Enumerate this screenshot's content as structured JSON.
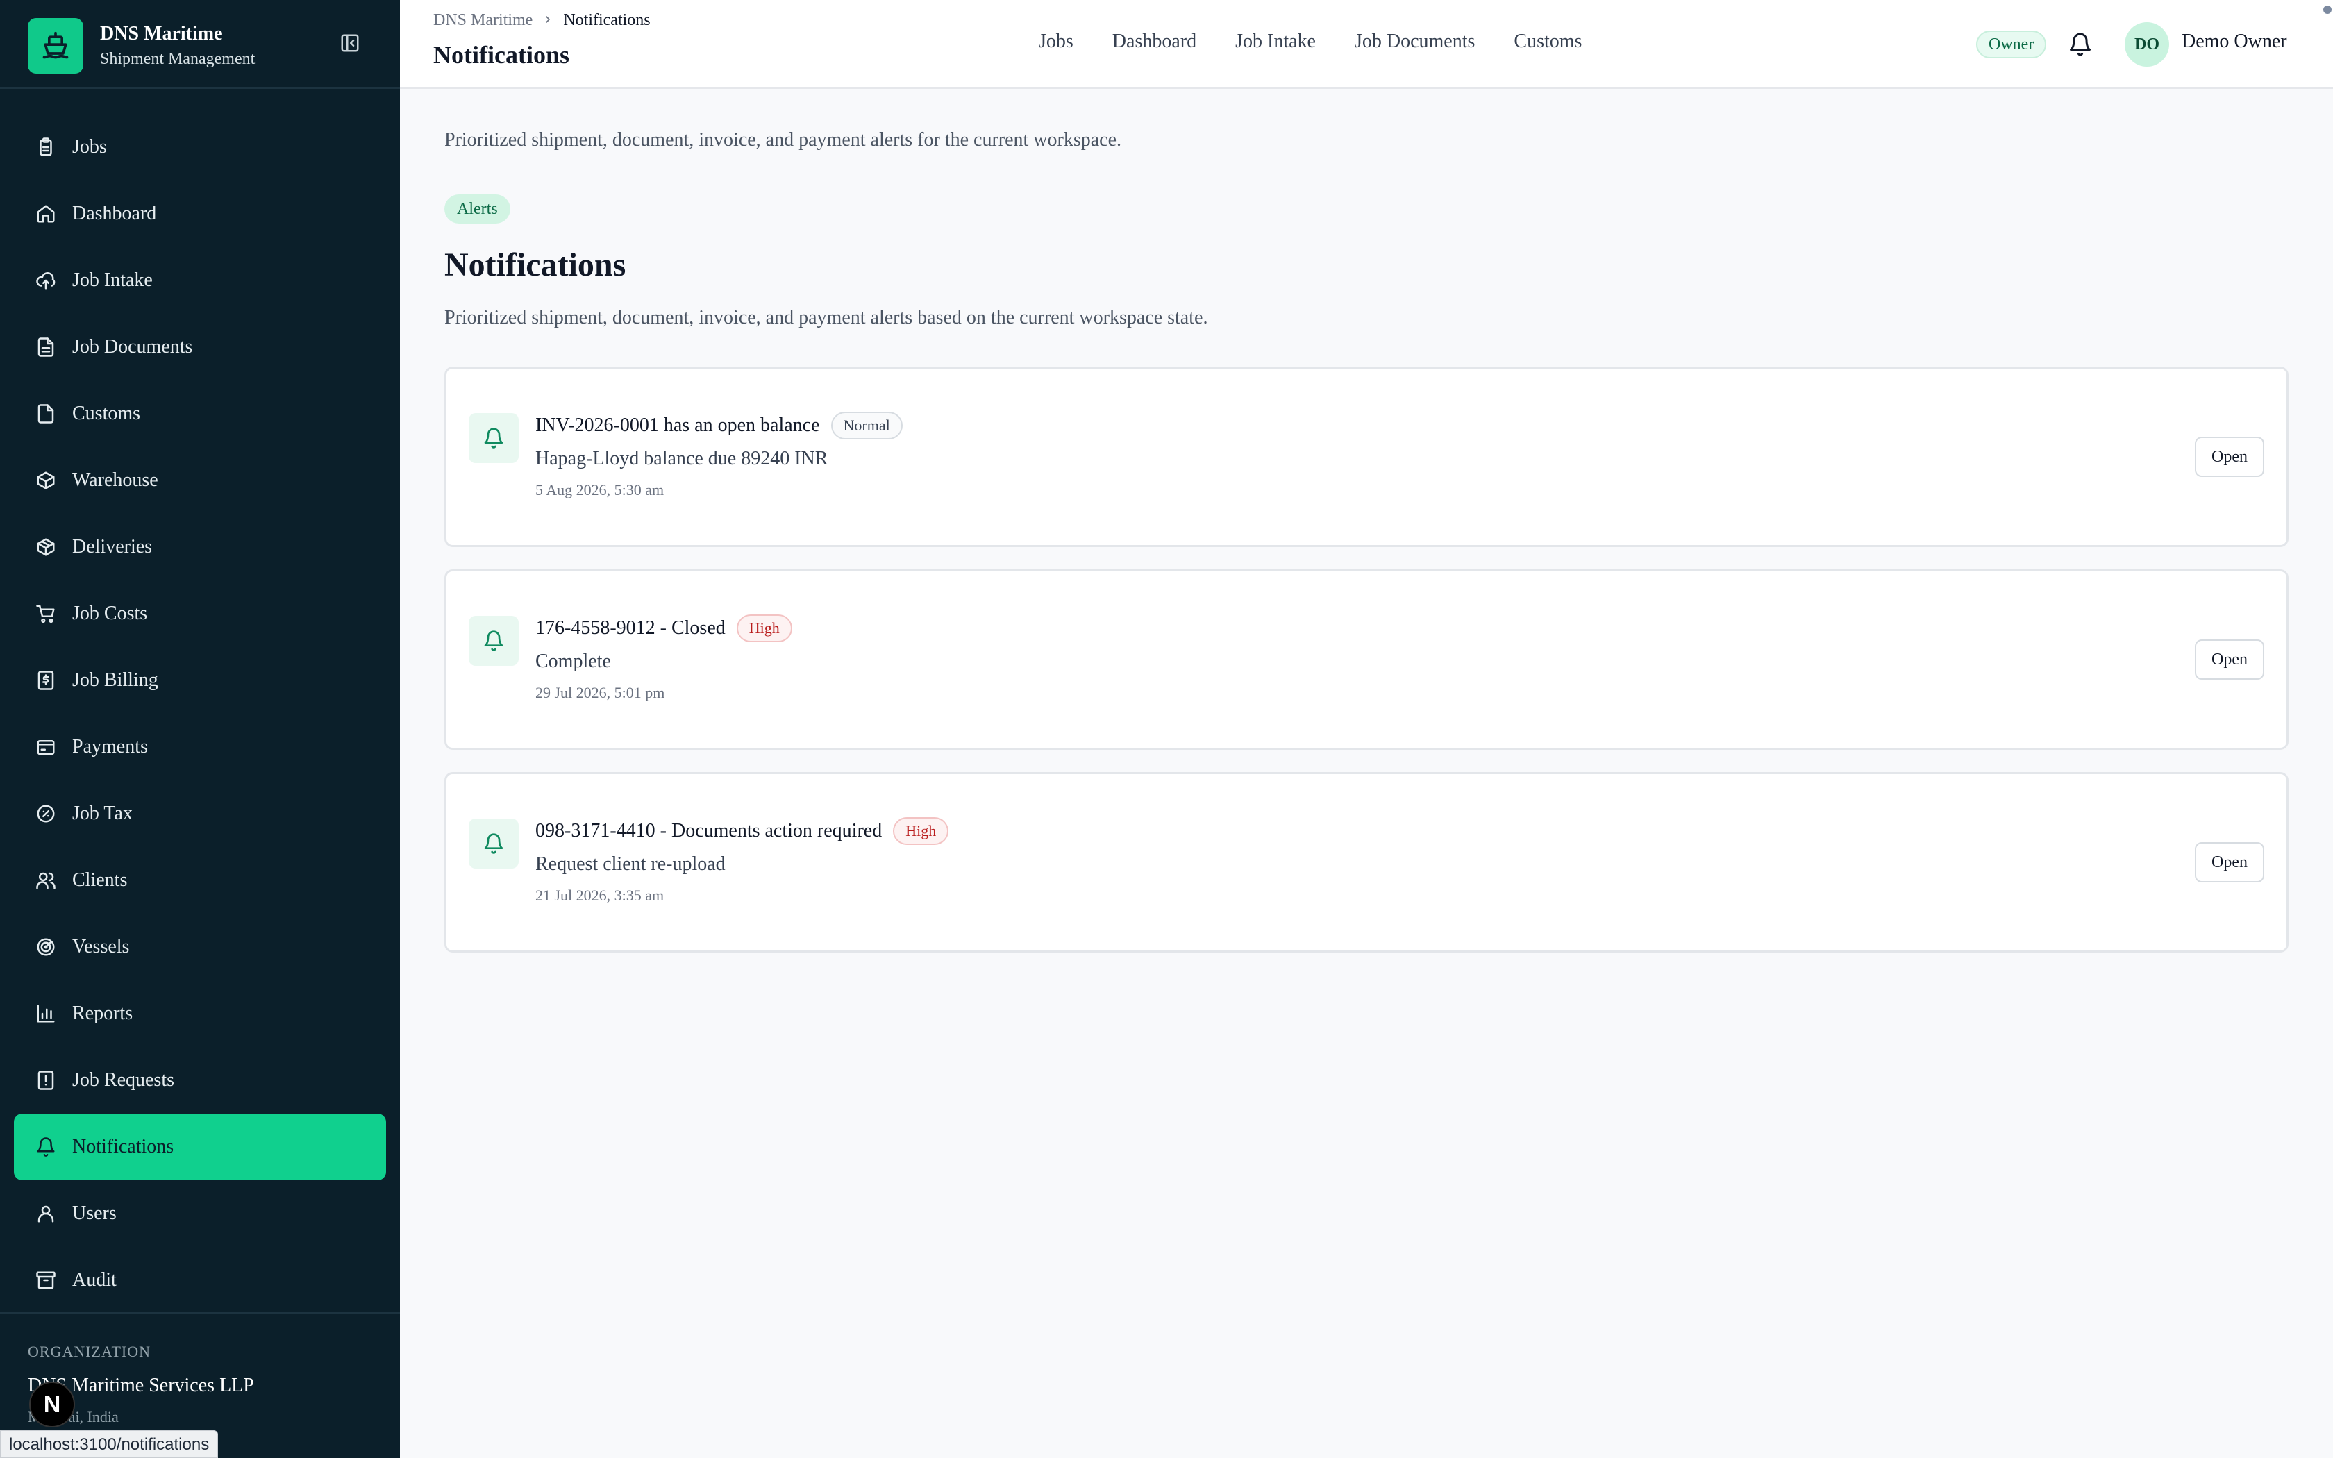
{
  "brand": {
    "title": "DNS Maritime",
    "subtitle": "Shipment Management"
  },
  "sidebar": {
    "items": [
      {
        "label": "Jobs",
        "icon": "clipboard-icon",
        "active": false
      },
      {
        "label": "Dashboard",
        "icon": "home-icon",
        "active": false
      },
      {
        "label": "Job Intake",
        "icon": "upload-cloud-icon",
        "active": false
      },
      {
        "label": "Job Documents",
        "icon": "file-text-icon",
        "active": false
      },
      {
        "label": "Customs",
        "icon": "file-check-icon",
        "active": false
      },
      {
        "label": "Warehouse",
        "icon": "box-icon",
        "active": false
      },
      {
        "label": "Deliveries",
        "icon": "package-icon",
        "active": false
      },
      {
        "label": "Job Costs",
        "icon": "cart-icon",
        "active": false
      },
      {
        "label": "Job Billing",
        "icon": "dollar-receipt-icon",
        "active": false
      },
      {
        "label": "Payments",
        "icon": "wallet-icon",
        "active": false
      },
      {
        "label": "Job Tax",
        "icon": "percent-badge-icon",
        "active": false
      },
      {
        "label": "Clients",
        "icon": "users-icon",
        "active": false
      },
      {
        "label": "Vessels",
        "icon": "radar-icon",
        "active": false
      },
      {
        "label": "Reports",
        "icon": "bar-chart-icon",
        "active": false
      },
      {
        "label": "Job Requests",
        "icon": "alert-file-icon",
        "active": false
      },
      {
        "label": "Notifications",
        "icon": "bell-icon",
        "active": true
      },
      {
        "label": "Users",
        "icon": "user-icon",
        "active": false
      },
      {
        "label": "Audit",
        "icon": "archive-icon",
        "active": false
      }
    ],
    "org_label": "ORGANIZATION",
    "org_name": "DNS Maritime Services LLP",
    "org_location": "Mumbai, India"
  },
  "status_url": "localhost:3100/notifications",
  "header": {
    "breadcrumb_root": "DNS Maritime",
    "breadcrumb_current": "Notifications",
    "title": "Notifications",
    "nav": [
      "Jobs",
      "Dashboard",
      "Job Intake",
      "Job Documents",
      "Customs"
    ],
    "role": "Owner",
    "avatar_initials": "DO",
    "user_name": "Demo Owner"
  },
  "main": {
    "intro": "Prioritized shipment, document, invoice, and payment alerts for the current workspace.",
    "pill": "Alerts",
    "title": "Notifications",
    "description": "Prioritized shipment, document, invoice, and payment alerts based on the current workspace state.",
    "notifications": [
      {
        "title": "INV-2026-0001 has an open balance",
        "priority": "Normal",
        "body": "Hapag-Lloyd balance due 89240 INR",
        "time": "5 Aug 2026, 5:30 am",
        "action": "Open"
      },
      {
        "title": "176-4558-9012 - Closed",
        "priority": "High",
        "body": "Complete",
        "time": "29 Jul 2026, 5:01 pm",
        "action": "Open"
      },
      {
        "title": "098-3171-4410 - Documents action required",
        "priority": "High",
        "body": "Request client re-upload",
        "time": "21 Jul 2026, 3:35 am",
        "action": "Open"
      }
    ]
  },
  "colors": {
    "sidebar_bg": "#0b1f2a",
    "accent": "#10d08e",
    "high": "#b91c1c"
  }
}
